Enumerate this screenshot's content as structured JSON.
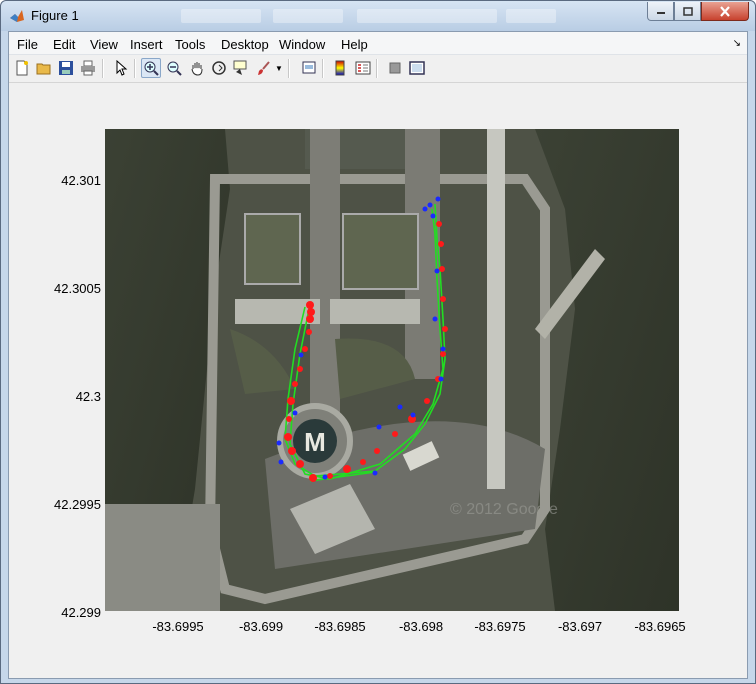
{
  "window": {
    "title": "Figure 1",
    "controls": [
      "minimize",
      "maximize",
      "close"
    ]
  },
  "menubar": {
    "items": [
      {
        "label": "File"
      },
      {
        "label": "Edit"
      },
      {
        "label": "View"
      },
      {
        "label": "Insert"
      },
      {
        "label": "Tools"
      },
      {
        "label": "Desktop"
      },
      {
        "label": "Window"
      },
      {
        "label": "Help"
      }
    ]
  },
  "toolbar": {
    "buttons": [
      {
        "icon": "new-figure-icon"
      },
      {
        "icon": "open-file-icon"
      },
      {
        "icon": "save-icon"
      },
      {
        "icon": "print-icon"
      },
      {
        "icon": "edit-plot-arrow-icon"
      },
      {
        "icon": "zoom-in-icon",
        "active": true
      },
      {
        "icon": "zoom-out-icon"
      },
      {
        "icon": "pan-hand-icon"
      },
      {
        "icon": "rotate-3d-icon"
      },
      {
        "icon": "data-cursor-icon"
      },
      {
        "icon": "brush-icon"
      },
      {
        "icon": "link-plot-icon"
      },
      {
        "icon": "insert-colorbar-icon"
      },
      {
        "icon": "insert-legend-icon"
      },
      {
        "icon": "hide-plot-tools-icon"
      },
      {
        "icon": "show-plot-tools-icon"
      }
    ]
  },
  "plot": {
    "ytick_labels": [
      "42.301",
      "42.3005",
      "42.3",
      "42.2995",
      "42.299"
    ],
    "xtick_labels": [
      "-83.6995",
      "-83.699",
      "-83.6985",
      "-83.698",
      "-83.6975",
      "-83.697",
      "-83.6965"
    ],
    "watermark": "© 2012 Google",
    "colors": {
      "green_track": "#22dd22",
      "red_points": "#ff1a1a",
      "blue_points": "#1a2aff"
    }
  }
}
